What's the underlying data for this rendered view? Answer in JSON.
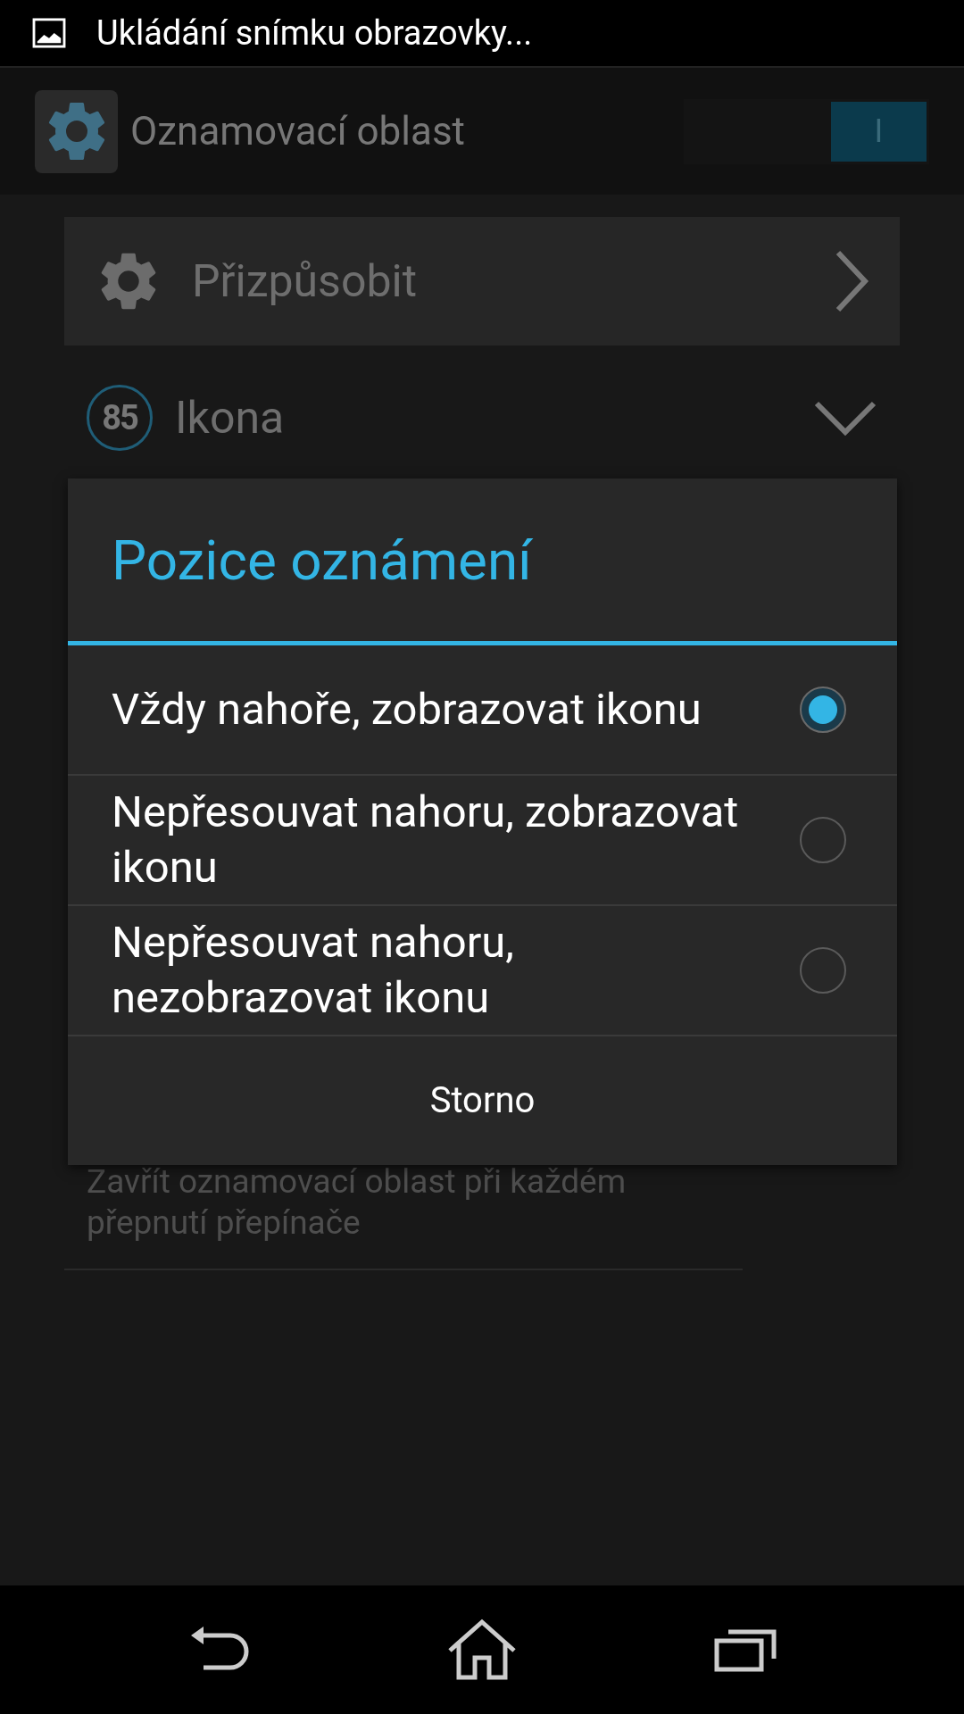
{
  "status_bar": {
    "notification": "Ukládání snímku obrazovky..."
  },
  "app_bar": {
    "title": "Oznamovací oblast",
    "switch": {
      "on": true,
      "label": "I"
    }
  },
  "settings": [
    {
      "kind": "link",
      "label": "Přizpůsobit"
    },
    {
      "kind": "expander",
      "badge": "85",
      "label": "Ikona",
      "expanded": false
    }
  ],
  "description": "Zavřít oznamovací oblast při každém přepnutí přepínače",
  "dialog": {
    "title": "Pozice oznámení",
    "options": [
      {
        "label": "Vždy nahoře, zobrazovat ikonu",
        "selected": true
      },
      {
        "label": "Nepřesouvat nahoru, zobrazovat ikonu",
        "selected": false
      },
      {
        "label": "Nepřesouvat nahoru, nezobrazovat ikonu",
        "selected": false
      }
    ],
    "cancel": "Storno"
  }
}
